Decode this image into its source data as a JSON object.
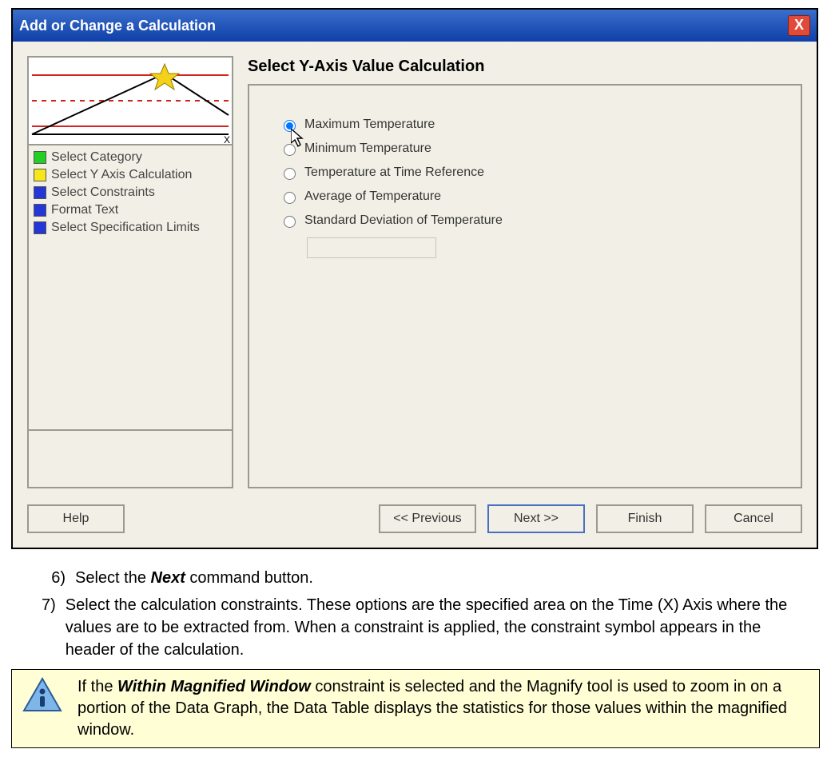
{
  "dialog": {
    "title": "Add or Change a Calculation",
    "close_glyph": "X",
    "panel_heading": "Select Y-Axis Value Calculation"
  },
  "wizard_steps": [
    {
      "color": "green",
      "label": "Select Category"
    },
    {
      "color": "yellow",
      "label": "Select Y Axis Calculation"
    },
    {
      "color": "blue",
      "label": "Select Constraints"
    },
    {
      "color": "blue",
      "label": "Format Text"
    },
    {
      "color": "blue",
      "label": "Select Specification Limits"
    }
  ],
  "options": [
    {
      "label": "Maximum Temperature",
      "selected": true
    },
    {
      "label": "Minimum Temperature",
      "selected": false
    },
    {
      "label": "Temperature at Time Reference",
      "selected": false
    },
    {
      "label": "Average of Temperature",
      "selected": false
    },
    {
      "label": "Standard Deviation of Temperature",
      "selected": false
    }
  ],
  "disabled_row_label": "",
  "buttons": {
    "help": "Help",
    "previous": "<< Previous",
    "next": "Next >>",
    "finish": "Finish",
    "cancel": "Cancel"
  },
  "instructions": {
    "step6_num": "6)",
    "step6_a": "Select the ",
    "step6_b": "Next",
    "step6_c": " command button.",
    "step7_num": "7)",
    "step7": "Select the calculation constraints. These options are the specified area on the Time (X) Axis where the values are to be extracted from. When a constraint is applied, the constraint symbol appears in the header of the calculation."
  },
  "note": {
    "a": "If the ",
    "b": "Within Magnified Window",
    "c": " constraint is selected and the Magnify tool is used to zoom in on a portion of the Data Graph, the Data Table displays the statistics for those values within the magnified window."
  },
  "preview_axis_label": "X"
}
